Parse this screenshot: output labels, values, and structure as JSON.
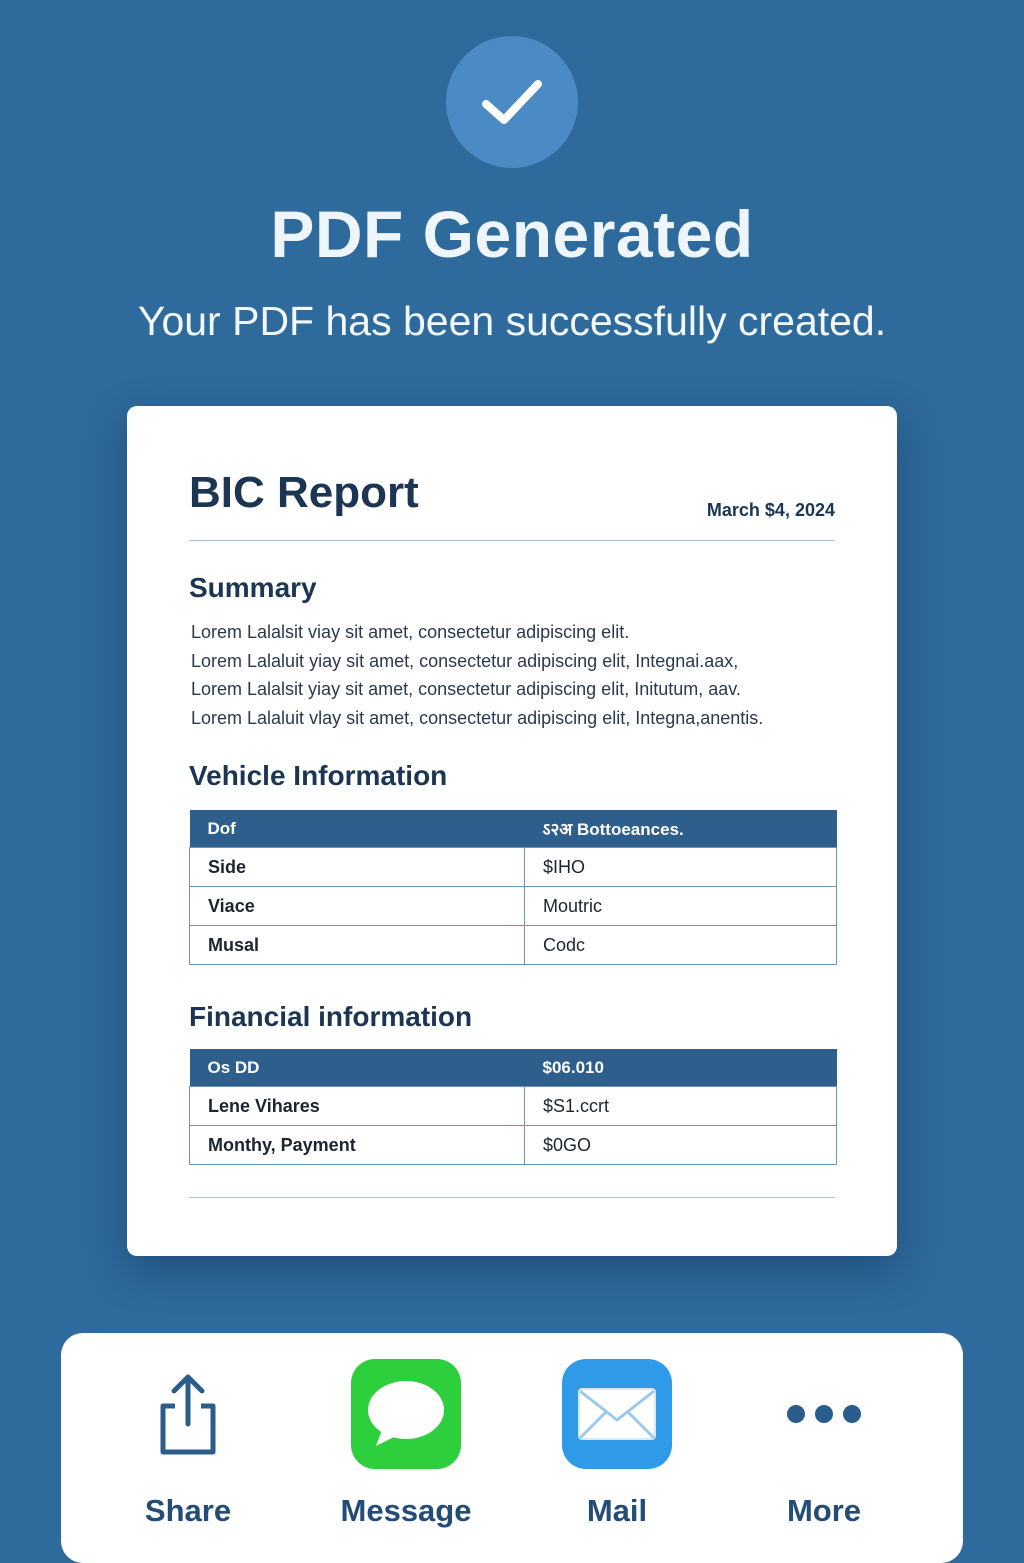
{
  "header": {
    "title": "PDF Generated",
    "subtitle": "Your PDF has been successfully created."
  },
  "document": {
    "title": "BIC Report",
    "date": "March $4, 2024",
    "summary_heading": "Summary",
    "summary_lines": [
      "Lorem Lalalsit viay sit amet, consectetur adipiscing elit.",
      "Lorem Lalaluit yiay sit amet, consectetur adipiscing elit, Integnai.aax,",
      "Lorem Lalalsit yiay sit amet, consectetur adipiscing elit, Initutum, aav.",
      "Lorem Lalaluit vlay sit amet, consectetur adipiscing elit, Integna,anentis."
    ],
    "vehicle_heading": "Vehicle Information",
    "vehicle_table": {
      "headers": [
        "Dof",
        "ऽ२अ Bottoeances."
      ],
      "rows": [
        [
          "Side",
          "$IHO"
        ],
        [
          "Viace",
          "Moutric"
        ],
        [
          "Musal",
          "Codc"
        ]
      ]
    },
    "financial_heading": "Financial information",
    "financial_table": {
      "headers": [
        "Os DD",
        "$06.010"
      ],
      "rows": [
        [
          "Lene Vihares",
          "$S1.ccrt"
        ],
        [
          "Monthy, Payment",
          "$0GO"
        ]
      ]
    }
  },
  "share_sheet": {
    "items": [
      {
        "label": "Share",
        "icon": "share-icon"
      },
      {
        "label": "Message",
        "icon": "message-icon"
      },
      {
        "label": "Mail",
        "icon": "mail-icon"
      },
      {
        "label": "More",
        "icon": "more-icon"
      }
    ]
  },
  "colors": {
    "background": "#2f6a9c",
    "check_circle": "#4a8bc6",
    "table_header": "#2e5f8c",
    "message_green": "#2ecf3c",
    "mail_blue": "#2f9be8",
    "share_blue": "#234c76"
  }
}
